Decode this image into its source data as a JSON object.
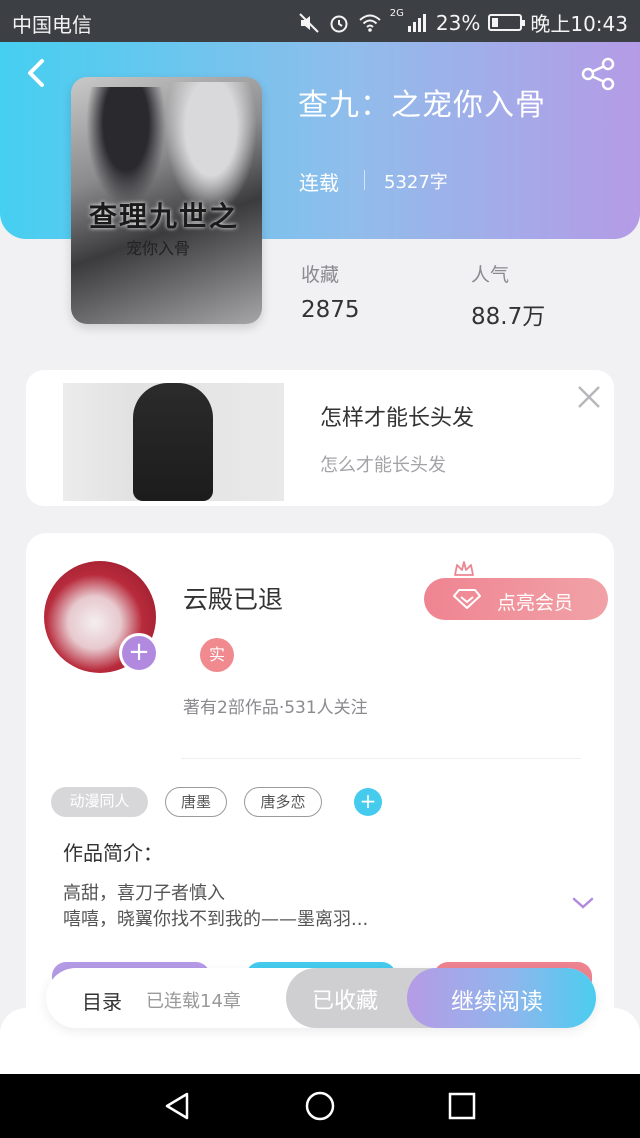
{
  "status_bar": {
    "carrier": "中国电信",
    "network": "2G",
    "battery": "23%",
    "battery_level": 0.23,
    "time": "晚上10:43"
  },
  "header": {
    "title": "查九：之宠你入骨",
    "status": "连载",
    "word_count": "5327字",
    "back_icon": "chevron-left-icon",
    "share_icon": "share-icon",
    "cover_title": "查理九世之",
    "cover_subtitle": "宠你入骨"
  },
  "stats": {
    "favorites_label": "收藏",
    "favorites_value": "2875",
    "popularity_label": "人气",
    "popularity_value": "88.7万"
  },
  "ad": {
    "title": "怎样才能长头发",
    "subtitle": "怎么才能长头发"
  },
  "author": {
    "name": "云殿已退",
    "verified_badge": "实",
    "vip_button": "点亮会员",
    "meta": "著有2部作品·531人关注"
  },
  "tags": [
    "动漫同人",
    "唐墨",
    "唐多恋"
  ],
  "intro": {
    "label": "作品简介：",
    "lines": [
      "高甜，喜刀子者慎入",
      "嘻嘻，晓翼你找不到我的——墨离羽..."
    ]
  },
  "action_bar": {
    "toc_label": "目录",
    "chapter_count": "已连载14章",
    "collected_button": "已收藏",
    "read_button": "继续阅读"
  },
  "colors": {
    "header_gradient_start": "#45cff1",
    "header_gradient_end": "#b59be6",
    "vip_pink": "#ef8491",
    "accent_purple": "#b18ae0",
    "tag_blue": "#45cbee"
  }
}
